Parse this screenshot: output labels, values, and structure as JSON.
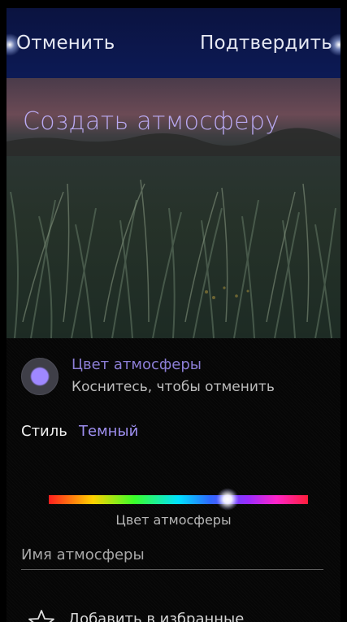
{
  "header": {
    "cancel_label": "Отменить",
    "confirm_label": "Подтвердить"
  },
  "title": "Создать атмосферу",
  "ambience_color": {
    "label": "Цвет атмосферы",
    "hint": "Коснитесь, чтобы отменить",
    "swatch_color": "#9f88ff"
  },
  "style": {
    "label": "Стиль",
    "value": "Темный"
  },
  "color_slider": {
    "caption": "Цвет атмосферы",
    "position_fraction": 0.69
  },
  "name_field": {
    "placeholder": "Имя атмосферы",
    "value": ""
  },
  "favorite": {
    "label": "Добавить в избранные",
    "icon": "star-outline-icon"
  },
  "colors": {
    "accent": "#9e8ff0",
    "header_bg": "#0c1a55",
    "background": "#060606"
  }
}
